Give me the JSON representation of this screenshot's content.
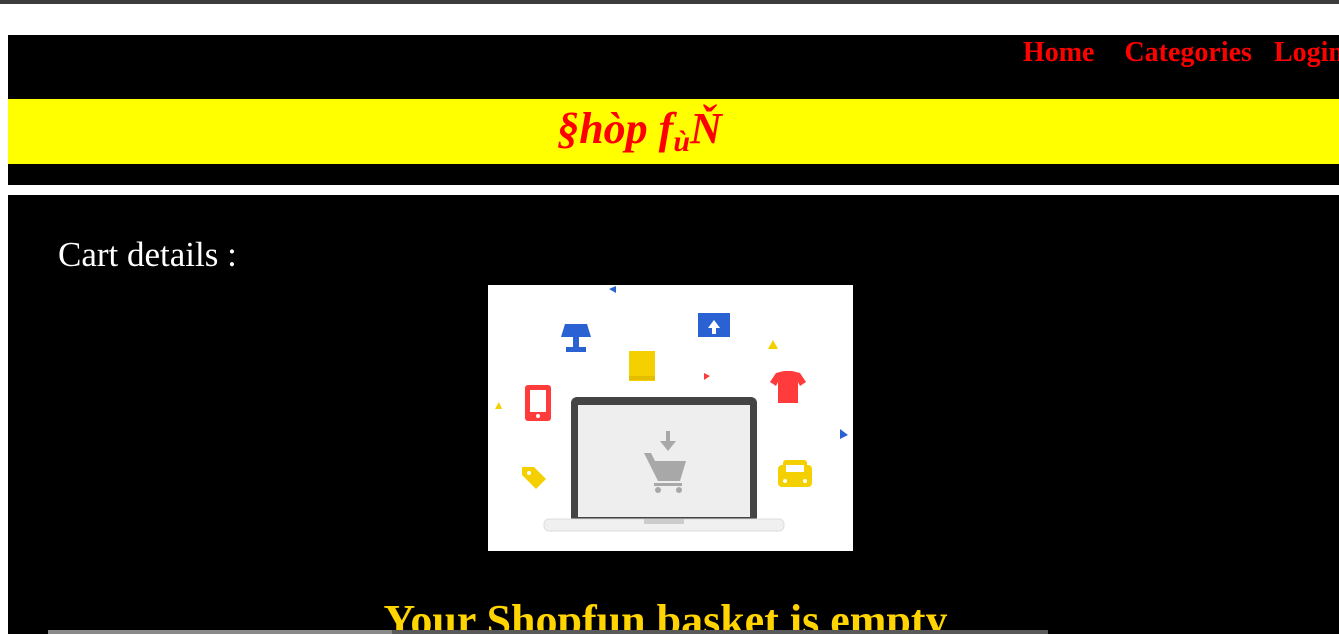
{
  "nav": {
    "home": "Home",
    "categories": "Categories",
    "login": "Login"
  },
  "brand": {
    "main": "§hòp f",
    "sub": "ù",
    "tail": "Ň"
  },
  "cart": {
    "label": "Cart details :",
    "illustration": "empty-cart-illustration",
    "empty_message": "Your Shopfun basket is empty"
  },
  "colors": {
    "header_bg": "#000000",
    "brand_band": "#ffff00",
    "brand_text": "#ff0000",
    "nav_text": "#ff0000",
    "empty_text": "#ffd400"
  }
}
